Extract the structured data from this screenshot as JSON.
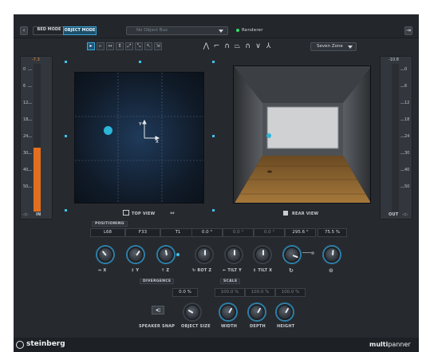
{
  "header": {
    "back_icon": "chevron-left-icon",
    "bed_mode_label": "BED MODE",
    "object_mode_label": "OBJECT MODE",
    "object_bus": {
      "placeholder": "No Object Bus",
      "selected": ""
    },
    "renderer_label": "Renderer",
    "renderer_status_color": "#33dd66",
    "collapse_icon": "panel-toggle-icon"
  },
  "toolbar": {
    "tools": [
      {
        "name": "select-tool",
        "glyph": "▸",
        "active": true
      },
      {
        "name": "select-object-tool",
        "glyph": "▹",
        "active": false
      },
      {
        "name": "move-horizontal-tool",
        "glyph": "↔",
        "active": false
      },
      {
        "name": "move-vertical-tool",
        "glyph": "⇕",
        "active": false
      },
      {
        "name": "move-diagonal-tool",
        "glyph": "⤢",
        "active": false
      },
      {
        "name": "move-diagonal-alt-tool",
        "glyph": "⤡",
        "active": false
      },
      {
        "name": "pointer-tool",
        "glyph": "↖",
        "active": false
      },
      {
        "name": "speaker-tool",
        "glyph": "⇲",
        "active": false
      }
    ],
    "paths": [
      {
        "name": "path-triangle",
        "glyph": "⋀"
      },
      {
        "name": "path-corner",
        "glyph": "⌐"
      },
      {
        "name": "path-arch",
        "glyph": "∩"
      },
      {
        "name": "path-trapezoid",
        "glyph": "⏢"
      },
      {
        "name": "path-round",
        "glyph": "∩"
      },
      {
        "name": "path-v",
        "glyph": "∨"
      },
      {
        "name": "path-lambda",
        "glyph": "⅄"
      }
    ],
    "zone_select": "Seven Zone"
  },
  "meters": {
    "in": {
      "label": "IN",
      "peak": "-7.3",
      "level": 0.43,
      "color": "#e36f1e"
    },
    "out": {
      "label": "OUT",
      "peak": "-10.8",
      "level": 0.0
    },
    "scale": [
      "0",
      "6",
      "12",
      "18",
      "24",
      "30",
      "40",
      "50"
    ]
  },
  "views": {
    "top_view_label": "TOP VIEW",
    "rear_view_label": "REAR VIEW",
    "axis_y": "Y",
    "axis_x": "X",
    "object_color": "#2bb6d8"
  },
  "positioning": {
    "section_label": "POSITIONING",
    "l": "L68",
    "f": "F33",
    "t": "T1",
    "rot_z": "0.0 °",
    "tilt_y": "0.0 °",
    "tilt_x": "0.0 °",
    "rotation": "295.6 °",
    "level": "75.5 %"
  },
  "knob_labels": {
    "x": "X",
    "y": "Y",
    "z": "Z",
    "rot_z": "ROT Z",
    "tilt_y": "TILT Y",
    "tilt_x": "TILT X"
  },
  "divergence": {
    "label": "DIVERGENCE",
    "value": "0.0 %"
  },
  "scale": {
    "label": "SCALE",
    "width": "100.0 %",
    "depth": "100.0 %",
    "height": "100.0 %"
  },
  "bottom_labels": {
    "speaker_snap": "SPEAKER SNAP",
    "object_size": "OBJECT SIZE",
    "width": "WIDTH",
    "depth": "DEPTH",
    "height": "HEIGHT"
  },
  "footer": {
    "brand": "steinberg",
    "product_bold": "multi",
    "product_rest": "panner"
  }
}
